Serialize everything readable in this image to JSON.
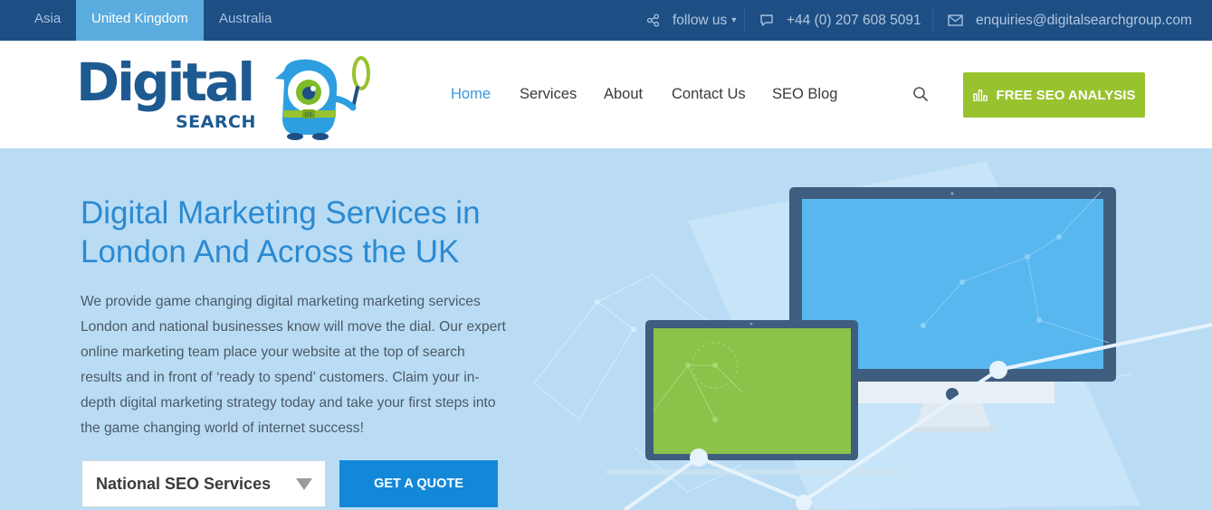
{
  "topbar": {
    "regions": [
      {
        "label": "Asia",
        "active": false
      },
      {
        "label": "United Kingdom",
        "active": true
      },
      {
        "label": "Australia",
        "active": false
      }
    ],
    "follow": {
      "label": "follow us",
      "icon": "share-icon",
      "caret": "▾"
    },
    "phone": {
      "label": "+44 (0) 207 608 5091",
      "icon": "chat-icon"
    },
    "email": {
      "label": "enquiries@digitalsearchgroup.com",
      "icon": "envelope-icon"
    }
  },
  "logo": {
    "word": "Digital",
    "sub": "SEARCH",
    "badge": "DS"
  },
  "nav": {
    "items": [
      {
        "label": "Home",
        "active": true
      },
      {
        "label": "Services",
        "active": false
      },
      {
        "label": "About",
        "active": false
      },
      {
        "label": "Contact Us",
        "active": false
      },
      {
        "label": "SEO Blog",
        "active": false
      }
    ],
    "search_icon": "search-icon",
    "cta": {
      "label": "FREE SEO ANALYSIS",
      "icon": "bar-chart-icon"
    }
  },
  "hero": {
    "title": "Digital Marketing Services in London And Across the UK",
    "body": "We provide game changing digital marketing marketing services London and national businesses know will move the dial. Our expert online marketing team place your website at the top of search results and in front of ‘ready to spend’ customers. Claim your in-depth digital marketing strategy today and take your first steps into the game changing world of internet success!",
    "select": {
      "value": "National SEO Services"
    },
    "quote_button": "GET A QUOTE"
  },
  "colors": {
    "topbar": "#1d4f85",
    "active_region": "#5aacdf",
    "accent_green": "#98c22e",
    "brand_blue": "#1d5a91",
    "hero_bg": "#b9dcf4",
    "title_blue": "#2b8ad2",
    "button_blue": "#1388d8"
  }
}
